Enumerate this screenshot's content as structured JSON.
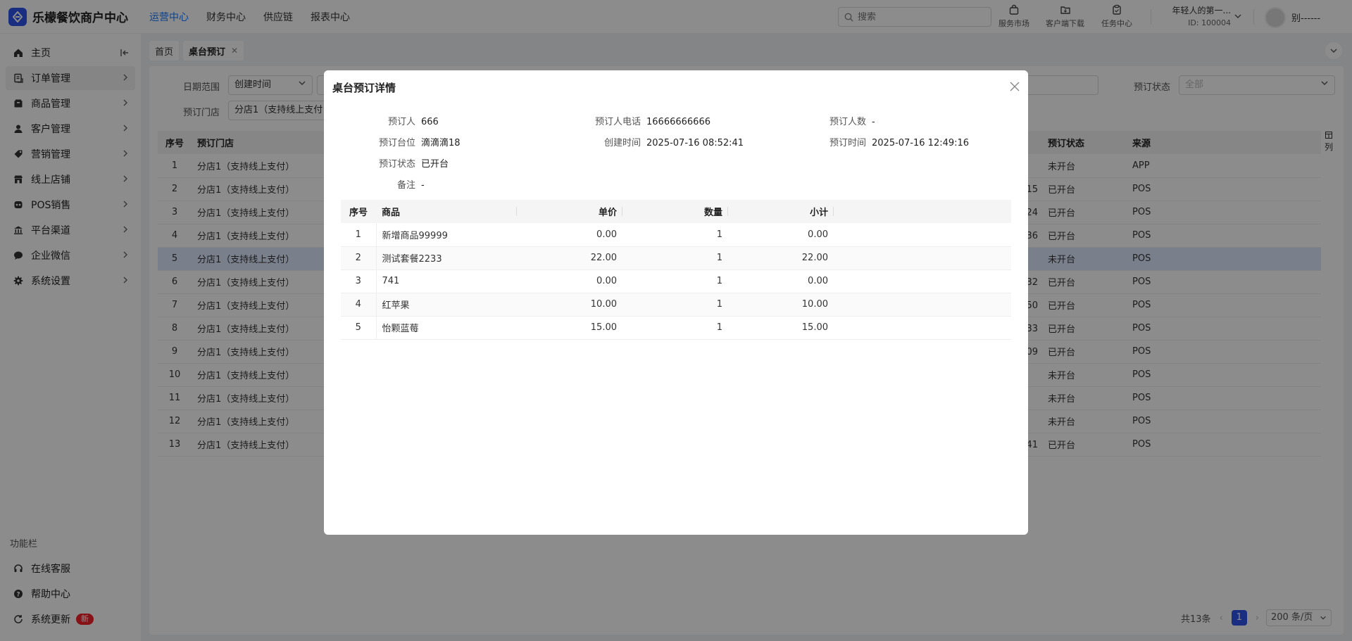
{
  "app": {
    "title": "乐檬餐饮商户中心"
  },
  "topnav": {
    "items": [
      "运营中心",
      "财务中心",
      "供应链",
      "报表中心"
    ],
    "active_index": 0
  },
  "search": {
    "placeholder": "搜索",
    "value": ""
  },
  "tools": {
    "service_market": "服务市场",
    "client_download": "客户端下载",
    "task_center": "任务中心"
  },
  "merchant": {
    "name": "年轻人的第一...",
    "id": "ID: 100004"
  },
  "user": {
    "name": "别------"
  },
  "sidebar": {
    "items": [
      "主页",
      "订单管理",
      "商品管理",
      "客户管理",
      "营销管理",
      "线上店铺",
      "POS销售",
      "平台渠道",
      "企业微信",
      "系统设置"
    ],
    "active_index": 1,
    "func_title": "功能栏",
    "func_items": [
      "在线客服",
      "帮助中心",
      "系统更新"
    ],
    "update_badge": "新"
  },
  "tabs": {
    "items": [
      "首页",
      "桌台预订"
    ],
    "active_index": 1
  },
  "filters": {
    "date_range_label": "日期范围",
    "date_range_value": "创建时间",
    "store_label": "预订门店",
    "store_value": "分店1（支持线上支付",
    "status_label": "预订状态",
    "status_value": "全部"
  },
  "table": {
    "headers": {
      "no": "序号",
      "store": "预订门店",
      "status": "预订状态",
      "source": "来源"
    },
    "column_toggle": "列",
    "rows": [
      {
        "no": "1",
        "store": "分店1（支持线上支付）",
        "frag": "",
        "status": "未开台",
        "source": "APP"
      },
      {
        "no": "2",
        "store": "分店1（支持线上支付）",
        "frag": "15",
        "status": "已开台",
        "source": "POS"
      },
      {
        "no": "3",
        "store": "分店1（支持线上支付）",
        "frag": "24",
        "status": "已开台",
        "source": "POS"
      },
      {
        "no": "4",
        "store": "分店1（支持线上支付）",
        "frag": "36",
        "status": "已开台",
        "source": "POS"
      },
      {
        "no": "5",
        "store": "分店1（支持线上支付）",
        "frag": "",
        "status": "未开台",
        "source": "POS"
      },
      {
        "no": "6",
        "store": "分店1（支持线上支付）",
        "frag": "32",
        "status": "已开台",
        "source": "POS"
      },
      {
        "no": "7",
        "store": "分店1（支持线上支付）",
        "frag": "50",
        "status": "已开台",
        "source": "POS"
      },
      {
        "no": "8",
        "store": "分店1（支持线上支付）",
        "frag": "33",
        "status": "已开台",
        "source": "POS"
      },
      {
        "no": "9",
        "store": "分店1（支持线上支付）",
        "frag": "09",
        "status": "已开台",
        "source": "POS"
      },
      {
        "no": "10",
        "store": "分店1（支持线上支付）",
        "frag": "",
        "status": "未开台",
        "source": "POS"
      },
      {
        "no": "11",
        "store": "分店1（支持线上支付）",
        "frag": "",
        "status": "未开台",
        "source": "POS"
      },
      {
        "no": "12",
        "store": "分店1（支持线上支付）",
        "frag": "",
        "status": "未开台",
        "source": "POS"
      },
      {
        "no": "13",
        "store": "分店1（支持线上支付）",
        "frag": "41",
        "status": "已开台",
        "source": "POS"
      }
    ],
    "highlighted_row": 5
  },
  "pagination": {
    "total": "共13条",
    "current_page": "1",
    "page_size": "200 条/页"
  },
  "modal": {
    "title": "桌台预订详情",
    "fields": {
      "booker_label": "预订人",
      "booker_value": "666",
      "phone_label": "预订人电话",
      "phone_value": "16666666666",
      "people_label": "预订人数",
      "people_value": "-",
      "table_label": "预订台位",
      "table_value": "滴滴滴18",
      "created_label": "创建时间",
      "created_value": "2025-07-16 08:52:41",
      "booking_time_label": "预订时间",
      "booking_time_value": "2025-07-16 12:49:16",
      "status_label": "预订状态",
      "status_value": "已开台",
      "remark_label": "备注",
      "remark_value": "-"
    },
    "items_table": {
      "headers": {
        "no": "序号",
        "product": "商品",
        "price": "单价",
        "qty": "数量",
        "subtotal": "小计"
      },
      "rows": [
        {
          "no": "1",
          "product": "新增商品99999",
          "price": "0.00",
          "qty": "1",
          "subtotal": "0.00"
        },
        {
          "no": "2",
          "product": "测试套餐2233",
          "price": "22.00",
          "qty": "1",
          "subtotal": "22.00"
        },
        {
          "no": "3",
          "product": "741",
          "price": "0.00",
          "qty": "1",
          "subtotal": "0.00"
        },
        {
          "no": "4",
          "product": "红苹果",
          "price": "10.00",
          "qty": "1",
          "subtotal": "10.00"
        },
        {
          "no": "5",
          "product": "怡颗蓝莓",
          "price": "15.00",
          "qty": "1",
          "subtotal": "15.00"
        }
      ]
    }
  }
}
